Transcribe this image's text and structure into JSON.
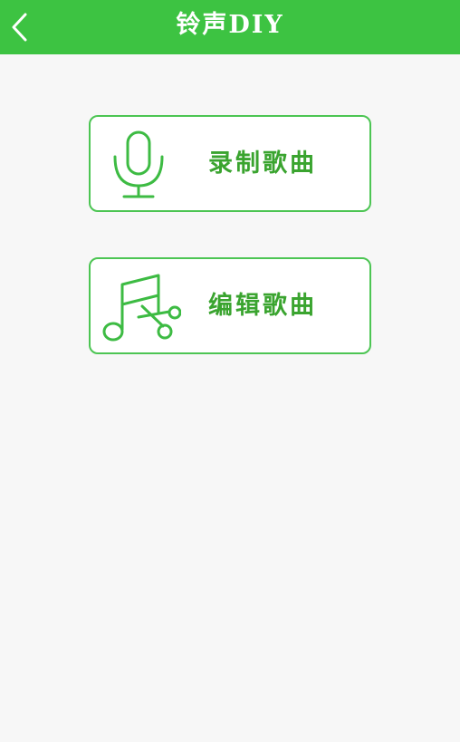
{
  "header": {
    "title": "铃声DIY",
    "back_icon": "chevron-left-icon"
  },
  "menu": {
    "items": [
      {
        "label": "录制歌曲",
        "icon": "microphone-icon"
      },
      {
        "label": "编辑歌曲",
        "icon": "music-scissors-icon"
      }
    ]
  },
  "colors": {
    "header_bg": "#3dc342",
    "card_border": "#4cc553",
    "label_text": "#3aa42f",
    "page_bg": "#f7f7f7"
  }
}
